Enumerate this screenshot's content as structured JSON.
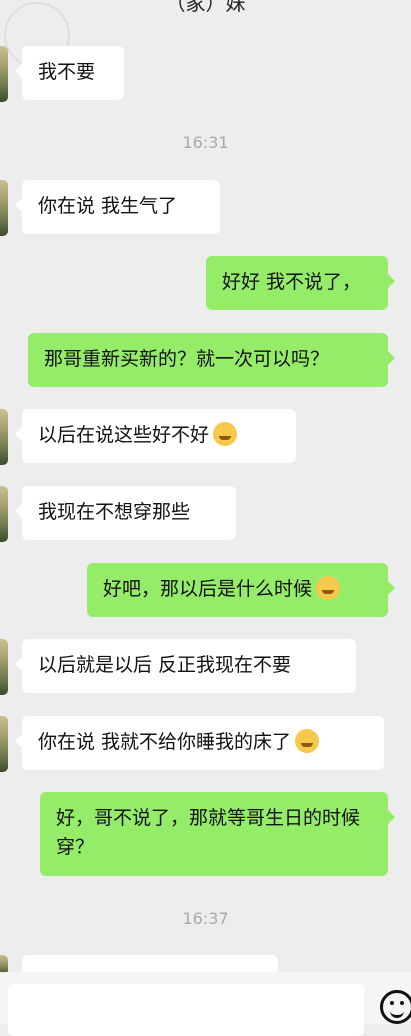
{
  "header": {
    "title": "（家）妹"
  },
  "messages": [
    {
      "side": "left",
      "text": "我不要"
    },
    {
      "type": "time",
      "text": "16:31"
    },
    {
      "side": "left",
      "text": "你在说 我生气了"
    },
    {
      "side": "right",
      "text": "好好 我不说了，"
    },
    {
      "side": "right",
      "text": "那哥重新买新的？就一次可以吗？"
    },
    {
      "side": "left",
      "text": "以后在说这些好不好",
      "emoji": "pleading-face-icon"
    },
    {
      "side": "left",
      "text": "我现在不想穿那些"
    },
    {
      "side": "right",
      "text": "好吧，那以后是什么时候",
      "emoji": "grinning-face-icon"
    },
    {
      "side": "left",
      "text": "以后就是以后 反正我现在不要"
    },
    {
      "side": "left",
      "text": "你在说 我就不给你睡我的床了",
      "emoji": "thinking-face-icon"
    },
    {
      "side": "right",
      "text": "好，哥不说了，那就等哥生日的时候穿？"
    },
    {
      "type": "time",
      "text": "16:37"
    }
  ],
  "input": {
    "placeholder": ""
  },
  "icons": {
    "emoji_button": "smile-icon"
  }
}
